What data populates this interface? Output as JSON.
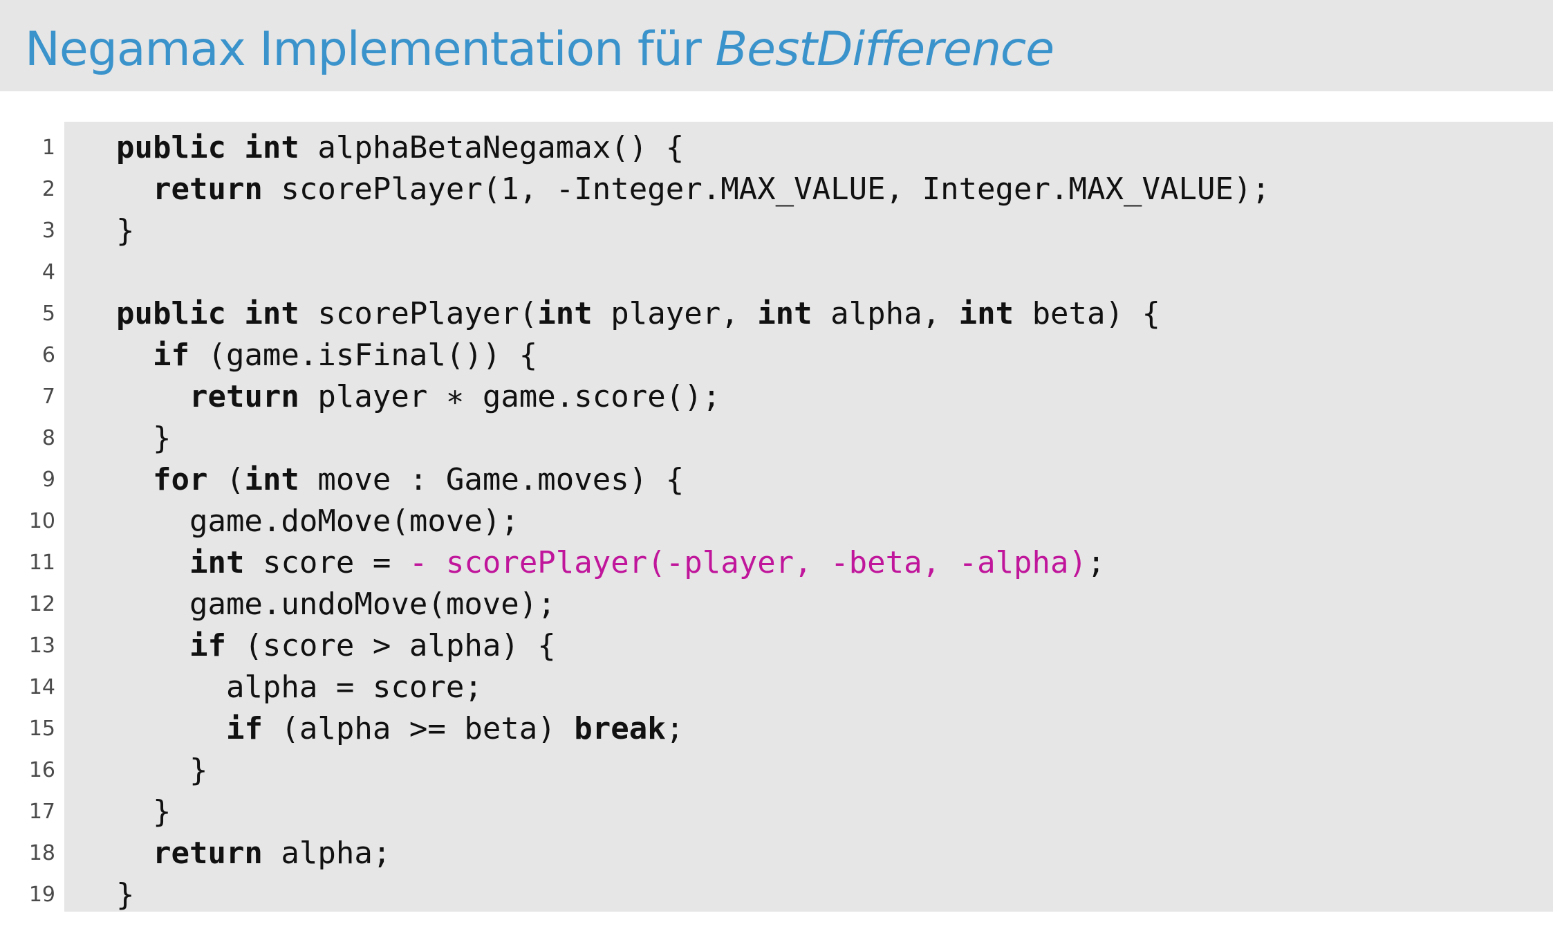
{
  "title": {
    "prefix": "Negamax Implementation für ",
    "emphasis": "BestDifference"
  },
  "code": {
    "lines": [
      {
        "num": "1",
        "parts": [
          [
            "kw",
            "public int"
          ],
          [
            "",
            " alphaBetaNegamax() {"
          ]
        ]
      },
      {
        "num": "2",
        "parts": [
          [
            "",
            "  "
          ],
          [
            "kw",
            "return"
          ],
          [
            "",
            " scorePlayer(1, -Integer.MAX_VALUE, Integer.MAX_VALUE);"
          ]
        ]
      },
      {
        "num": "3",
        "parts": [
          [
            "",
            "}"
          ]
        ]
      },
      {
        "num": "4",
        "parts": []
      },
      {
        "num": "5",
        "parts": [
          [
            "kw",
            "public int"
          ],
          [
            "",
            " scorePlayer("
          ],
          [
            "kw",
            "int"
          ],
          [
            "",
            " player, "
          ],
          [
            "kw",
            "int"
          ],
          [
            "",
            " alpha, "
          ],
          [
            "kw",
            "int"
          ],
          [
            "",
            " beta) {"
          ]
        ]
      },
      {
        "num": "6",
        "parts": [
          [
            "",
            "  "
          ],
          [
            "kw",
            "if"
          ],
          [
            "",
            " (game.isFinal()) {"
          ]
        ]
      },
      {
        "num": "7",
        "parts": [
          [
            "",
            "    "
          ],
          [
            "kw",
            "return"
          ],
          [
            "",
            " player ∗ game.score();"
          ]
        ]
      },
      {
        "num": "8",
        "parts": [
          [
            "",
            "  }"
          ]
        ]
      },
      {
        "num": "9",
        "parts": [
          [
            "",
            "  "
          ],
          [
            "kw",
            "for"
          ],
          [
            "",
            " ("
          ],
          [
            "kw",
            "int"
          ],
          [
            "",
            " move : Game.moves) {"
          ]
        ]
      },
      {
        "num": "10",
        "parts": [
          [
            "",
            "    game.doMove(move);"
          ]
        ]
      },
      {
        "num": "11",
        "parts": [
          [
            "",
            "    "
          ],
          [
            "kw",
            "int"
          ],
          [
            "",
            " score = "
          ],
          [
            "hl",
            "- scorePlayer(-player, -beta, -alpha)"
          ],
          [
            "",
            ";"
          ]
        ]
      },
      {
        "num": "12",
        "parts": [
          [
            "",
            "    game.undoMove(move);"
          ]
        ]
      },
      {
        "num": "13",
        "parts": [
          [
            "",
            "    "
          ],
          [
            "kw",
            "if"
          ],
          [
            "",
            " (score > alpha) {"
          ]
        ]
      },
      {
        "num": "14",
        "parts": [
          [
            "",
            "      alpha = score;"
          ]
        ]
      },
      {
        "num": "15",
        "parts": [
          [
            "",
            "      "
          ],
          [
            "kw",
            "if"
          ],
          [
            "",
            " (alpha >= beta) "
          ],
          [
            "kw",
            "break"
          ],
          [
            "",
            ";"
          ]
        ]
      },
      {
        "num": "16",
        "parts": [
          [
            "",
            "    }"
          ]
        ]
      },
      {
        "num": "17",
        "parts": [
          [
            "",
            "  }"
          ]
        ]
      },
      {
        "num": "18",
        "parts": [
          [
            "",
            "  "
          ],
          [
            "kw",
            "return"
          ],
          [
            "",
            " alpha;"
          ]
        ]
      },
      {
        "num": "19",
        "parts": [
          [
            "",
            "}"
          ]
        ]
      }
    ]
  },
  "colors": {
    "title": "#3b93cc",
    "highlight": "#c0169b",
    "panel": "#e6e6e6"
  }
}
